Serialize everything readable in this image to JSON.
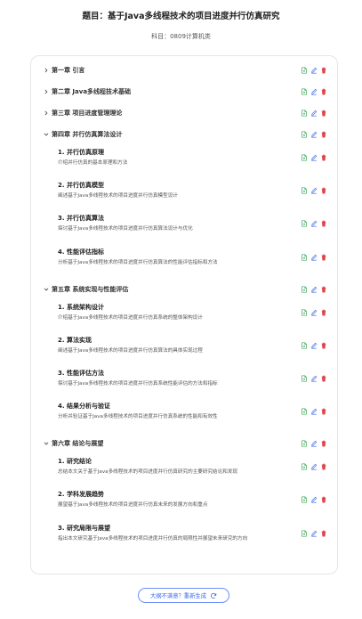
{
  "header": {
    "title": "题目：基于Java多线程技术的项目进度并行仿真研究",
    "subtitle": "科目：0809计算机类"
  },
  "outline": {
    "chapters": [
      {
        "label": "第一章 引言",
        "expanded": false,
        "sections": []
      },
      {
        "label": "第二章 Java多线程技术基础",
        "expanded": false,
        "sections": []
      },
      {
        "label": "第三章 项目进度管理理论",
        "expanded": false,
        "sections": []
      },
      {
        "label": "第四章 并行仿真算法设计",
        "expanded": true,
        "sections": [
          {
            "title": "1. 并行仿真原理",
            "desc": "介绍并行仿真的基本原理和方法"
          },
          {
            "title": "2. 并行仿真模型",
            "desc": "阐述基于Java多线程技术的项目进度并行仿真模型设计"
          },
          {
            "title": "3. 并行仿真算法",
            "desc": "探讨基于Java多线程技术的项目进度并行仿真算法设计与优化"
          },
          {
            "title": "4. 性能评估指标",
            "desc": "分析基于Java多线程技术的项目进度并行仿真算法的性能评估指标和方法"
          }
        ]
      },
      {
        "label": "第五章 系统实现与性能评估",
        "expanded": true,
        "sections": [
          {
            "title": "1. 系统架构设计",
            "desc": "介绍基于Java多线程技术的项目进度并行仿真系统的整体架构设计"
          },
          {
            "title": "2. 算法实现",
            "desc": "阐述基于Java多线程技术的项目进度并行仿真算法的具体实现过程"
          },
          {
            "title": "3. 性能评估方法",
            "desc": "探讨基于Java多线程技术的项目进度并行仿真系统性能评估的方法和指标"
          },
          {
            "title": "4. 结果分析与验证",
            "desc": "分析并验证基于Java多线程技术的项目进度并行仿真系统的性能和有效性"
          }
        ]
      },
      {
        "label": "第六章 结论与展望",
        "expanded": true,
        "sections": [
          {
            "title": "1. 研究结论",
            "desc": "总结本文关于基于Java多线程技术的项目进度并行仿真研究的主要研究结论和发现"
          },
          {
            "title": "2. 学科发展趋势",
            "desc": "展望基于Java多线程技术的项目进度并行仿真未来的发展方向和重点"
          },
          {
            "title": "3. 研究局限与展望",
            "desc": "指出本文研究基于Java多线程技术的项目进度并行仿真的局限性并展望未来研究的方向"
          }
        ]
      }
    ]
  },
  "icons": {
    "chevron_collapsed": "chevron-right-icon",
    "chevron_expanded": "chevron-down-icon",
    "add": "document-add-icon",
    "edit": "pencil-icon",
    "delete": "trash-icon"
  },
  "colors": {
    "add_icon": "#3aa65a",
    "edit_icon": "#4a73e8",
    "delete_icon": "#e0454a",
    "regen_accent": "#3b6af0",
    "card_border": "#e6e6e6"
  },
  "footer": {
    "regenerate_label": "大纲不满意？重新生成"
  }
}
